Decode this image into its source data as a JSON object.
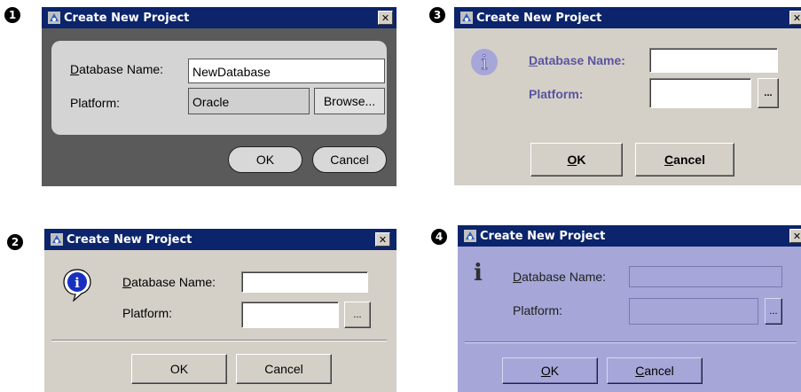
{
  "callouts": [
    "1",
    "2",
    "3",
    "4"
  ],
  "dialog1": {
    "title": "Create New Project",
    "close_glyph": "✕",
    "db_label_first": "D",
    "db_label_rest": "atabase Name:",
    "db_value": "NewDatabase",
    "platform_label": "Platform:",
    "platform_value": "Oracle",
    "browse_label": "Browse...",
    "ok_label": "OK",
    "cancel_label": "Cancel"
  },
  "dialog2": {
    "title": "Create New Project",
    "close_glyph": "✕",
    "info_icon": "i",
    "db_label_first": "D",
    "db_label_rest": "atabase Name:",
    "db_value": "",
    "platform_label": "Platform:",
    "platform_value": "",
    "ellipsis": "...",
    "ok_label": "OK",
    "cancel_label": "Cancel"
  },
  "dialog3": {
    "title": "Create New Project",
    "close_glyph": "✕",
    "info_icon": "i",
    "db_label_first": "D",
    "db_label_rest": "atabase Name:",
    "db_value": "",
    "platform_label": "Platform:",
    "platform_value": "",
    "ellipsis": "...",
    "ok_first": "O",
    "ok_rest": "K",
    "cancel_first": "C",
    "cancel_rest": "ancel"
  },
  "dialog4": {
    "title": "Create New Project",
    "close_glyph": "✕",
    "info_icon": "i",
    "db_label_first": "D",
    "db_label_rest": "atabase Name:",
    "db_value": "",
    "platform_label": "Platform:",
    "platform_value": "",
    "ellipsis": "...",
    "ok_first": "O",
    "ok_rest": "K",
    "cancel_first": "C",
    "cancel_rest": "ancel"
  },
  "colors": {
    "titlebar": "#0b246b",
    "dialog1_bg": "#5a5a5a",
    "dialog3_label": "#5a54a0",
    "dialog4_bg": "#a6a6d8"
  }
}
